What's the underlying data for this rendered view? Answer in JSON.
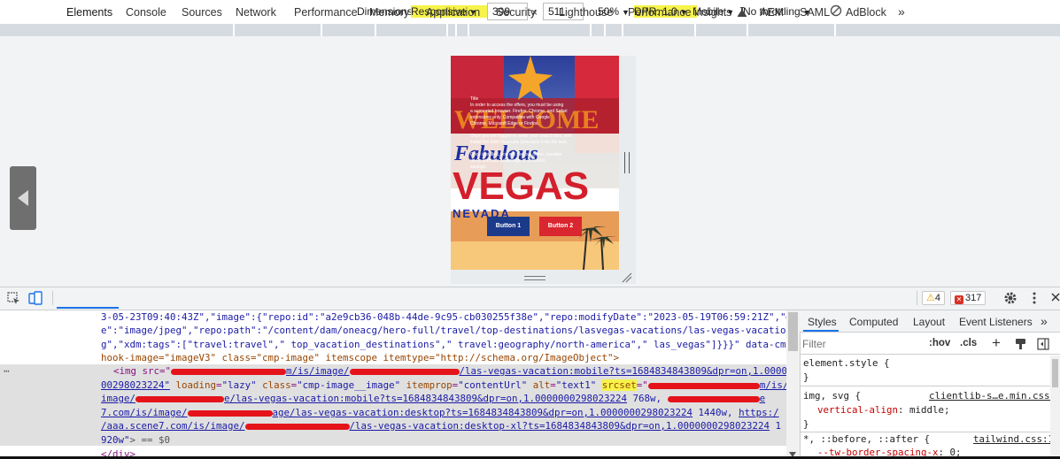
{
  "device_toolbar": {
    "dimensions_label": "Dimensions:",
    "dimensions_value": "Responsive",
    "width": "399",
    "times": "×",
    "height": "511",
    "zoom": "50%",
    "dpr": "DPR: 1.0",
    "mode": "Mobile",
    "throttling": "No throttling"
  },
  "hero": {
    "button1": "Button 1",
    "button2": "Button 2",
    "text_lines": [
      "Title",
      "In order to access the offers, you must be using",
      "a supported browser. Firefox, Chrome, and Safari",
      "extensions only. Compatible with Google",
      "Chrome, Microsoft Edge or Firefox.",
      "",
      "Once you are logged in, enter your search box, and",
      "install the AAA Discounts Extension from the web.",
      "",
      "Once installed, you will see our offers, member",
      "deals and take advantage of exclusive",
      "savings."
    ],
    "sign_words": {
      "welcome": "WELCOME",
      "fabulous": "Fabulous",
      "vegas": "VEGAS",
      "nevada": "NEVADA"
    }
  },
  "devtools": {
    "tabs": [
      "Elements",
      "Console",
      "Sources",
      "Network",
      "Performance",
      "Memory",
      "Application",
      "Security",
      "Lighthouse",
      "Performance insights",
      "AEM",
      "SAML",
      "AdBlock"
    ],
    "more": "»",
    "warnings": "4",
    "errors": "317"
  },
  "elements": {
    "line1": "3-05-23T09:40:43Z\",\"image\":{\"repo:id\":\"a2e9cb36-048b-44de-9c95-cb030255f38e\",\"repo:modifyDate\":\"2023-05-19T06:59:21Z\",\"@typ",
    "line2": "e\":\"image/jpeg\",\"repo:path\":\"/content/dam/oneacg/hero-full/travel/top-destinations/lasvegas-vacations/las-vegas-vacation.jp",
    "line3": "g\",\"xdm:tags\":[\"travel:travel\",\" top_vacation_destinations\",\" travel:geography/north-america\",\" las_vegas\"]}}}\" data-cmp-",
    "line4": "hook-image=\"imageV3\" class=\"cmp-image\" itemscope itemtype=\"http://schema.org/ImageObject\">",
    "ellipsis": "⋯",
    "img_open": "<img src=\"",
    "l5_a": "m/is/image/",
    "l5_b": "/las-vegas-vacation:mobile?ts=1684834843809&dpr=on,1.000000",
    "l6_a": "00298023224\"",
    "l6_loading": "loading",
    "l6_loading_val": "\"lazy\"",
    "l6_class": "class",
    "l6_class_val": "\"cmp-image__image\"",
    "l6_itemprop": "itemprop",
    "l6_itemprop_val": "\"contentUrl\"",
    "l6_alt": "alt",
    "l6_alt_val": "\"text1\"",
    "l6_srcset": "srcset",
    "l6_eq": "=\"",
    "l6_end": "m/is/",
    "l7_a": "image/",
    "l7_b": "e/las-vegas-vacation:mobile?ts=1684834843809&dpr=on,1.0000000298023224",
    "l7_c": " 768w, ",
    "l7_d": "e",
    "l8_a": "7.com/is/image/",
    "l8_b": "age/las-vegas-vacation:desktop?ts=1684834843809&dpr=on,1.0000000298023224",
    "l8_c": " 1440w, ",
    "l8_d": "https:/",
    "l9_a": "/aaa.scene7.com/is/image/",
    "l9_b": "/las-vegas-vacation:desktop-xl?ts=1684834843809&dpr=on,1.0000000298023224",
    "l9_c": " 1",
    "l10_a": "920w\"",
    "l10_b": "> == $0",
    "l11": "</div>"
  },
  "styles": {
    "tabs": [
      "Styles",
      "Computed",
      "Layout",
      "Event Listeners"
    ],
    "more": "»",
    "filter_placeholder": "Filter",
    "hov": ":hov",
    "cls": ".cls",
    "plus": "+",
    "element_style": "element.style {",
    "close_brace": "}",
    "rule2_selector": "img, svg {",
    "rule2_source": "clientlib-s…e.min.css:1",
    "rule2_prop": "vertical-align",
    "rule2_value": ": middle;",
    "rule3_selector": "*, ::before, ::after {",
    "rule3_source": "tailwind.css:14",
    "rule3_prop": "--tw-border-spacing-x",
    "rule3_value": ": 0;"
  },
  "colors": {
    "highlight": "#f6f34a",
    "accent": "#1a73e8",
    "button1": "#1c3a8a",
    "button2": "#d9262f",
    "redaction": "#e4141a"
  }
}
